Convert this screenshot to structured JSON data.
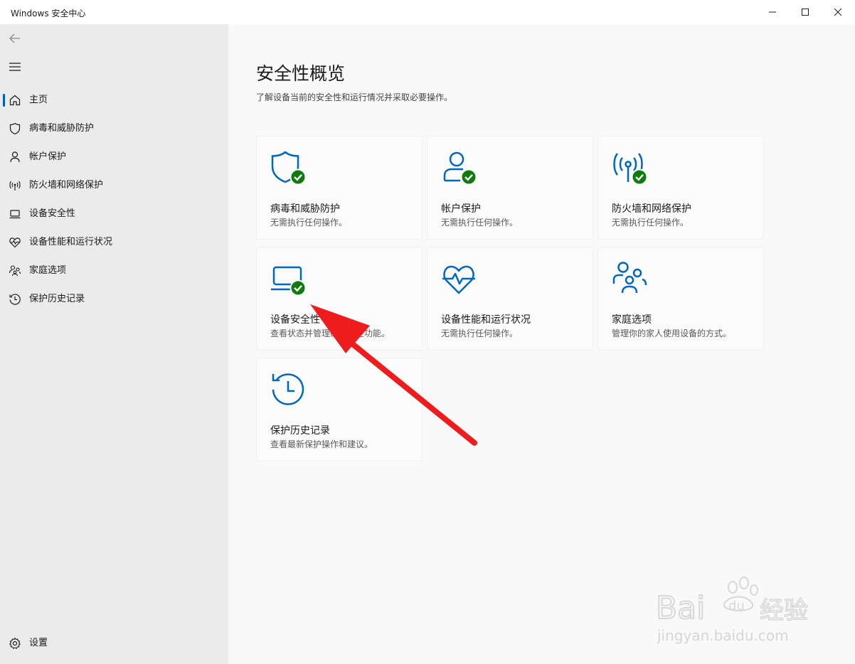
{
  "window": {
    "title": "Windows 安全中心"
  },
  "sidebar": {
    "items": [
      {
        "label": "主页",
        "icon": "home-icon"
      },
      {
        "label": "病毒和威胁防护",
        "icon": "shield-icon"
      },
      {
        "label": "帐户保护",
        "icon": "person-icon"
      },
      {
        "label": "防火墙和网络保护",
        "icon": "antenna-icon"
      },
      {
        "label": "设备安全性",
        "icon": "laptop-icon"
      },
      {
        "label": "设备性能和运行状况",
        "icon": "heart-pulse-icon"
      },
      {
        "label": "家庭选项",
        "icon": "family-icon"
      },
      {
        "label": "保护历史记录",
        "icon": "history-icon"
      }
    ],
    "settings_label": "设置"
  },
  "main": {
    "title": "安全性概览",
    "subtitle": "了解设备当前的安全性和运行情况并采取必要操作。",
    "cards": [
      {
        "title": "病毒和威胁防护",
        "desc": "无需执行任何操作。",
        "icon": "shield-check-icon"
      },
      {
        "title": "帐户保护",
        "desc": "无需执行任何操作。",
        "icon": "person-check-icon"
      },
      {
        "title": "防火墙和网络保护",
        "desc": "无需执行任何操作。",
        "icon": "antenna-check-icon"
      },
      {
        "title": "设备安全性",
        "desc": "查看状态并管理硬件安全功能。",
        "icon": "laptop-check-icon"
      },
      {
        "title": "设备性能和运行状况",
        "desc": "无需执行任何操作。",
        "icon": "heart-pulse-icon"
      },
      {
        "title": "家庭选项",
        "desc": "管理你的家人使用设备的方式。",
        "icon": "family-icon"
      },
      {
        "title": "保护历史记录",
        "desc": "查看最新保护操作和建议。",
        "icon": "history-icon"
      }
    ]
  },
  "watermark": {
    "text": "jingyan.baidu.com"
  },
  "colors": {
    "accent": "#005fb8",
    "icon_blue": "#0067c0",
    "ok_green": "#0f7b0f",
    "annotation_red": "#ee1c1c"
  }
}
